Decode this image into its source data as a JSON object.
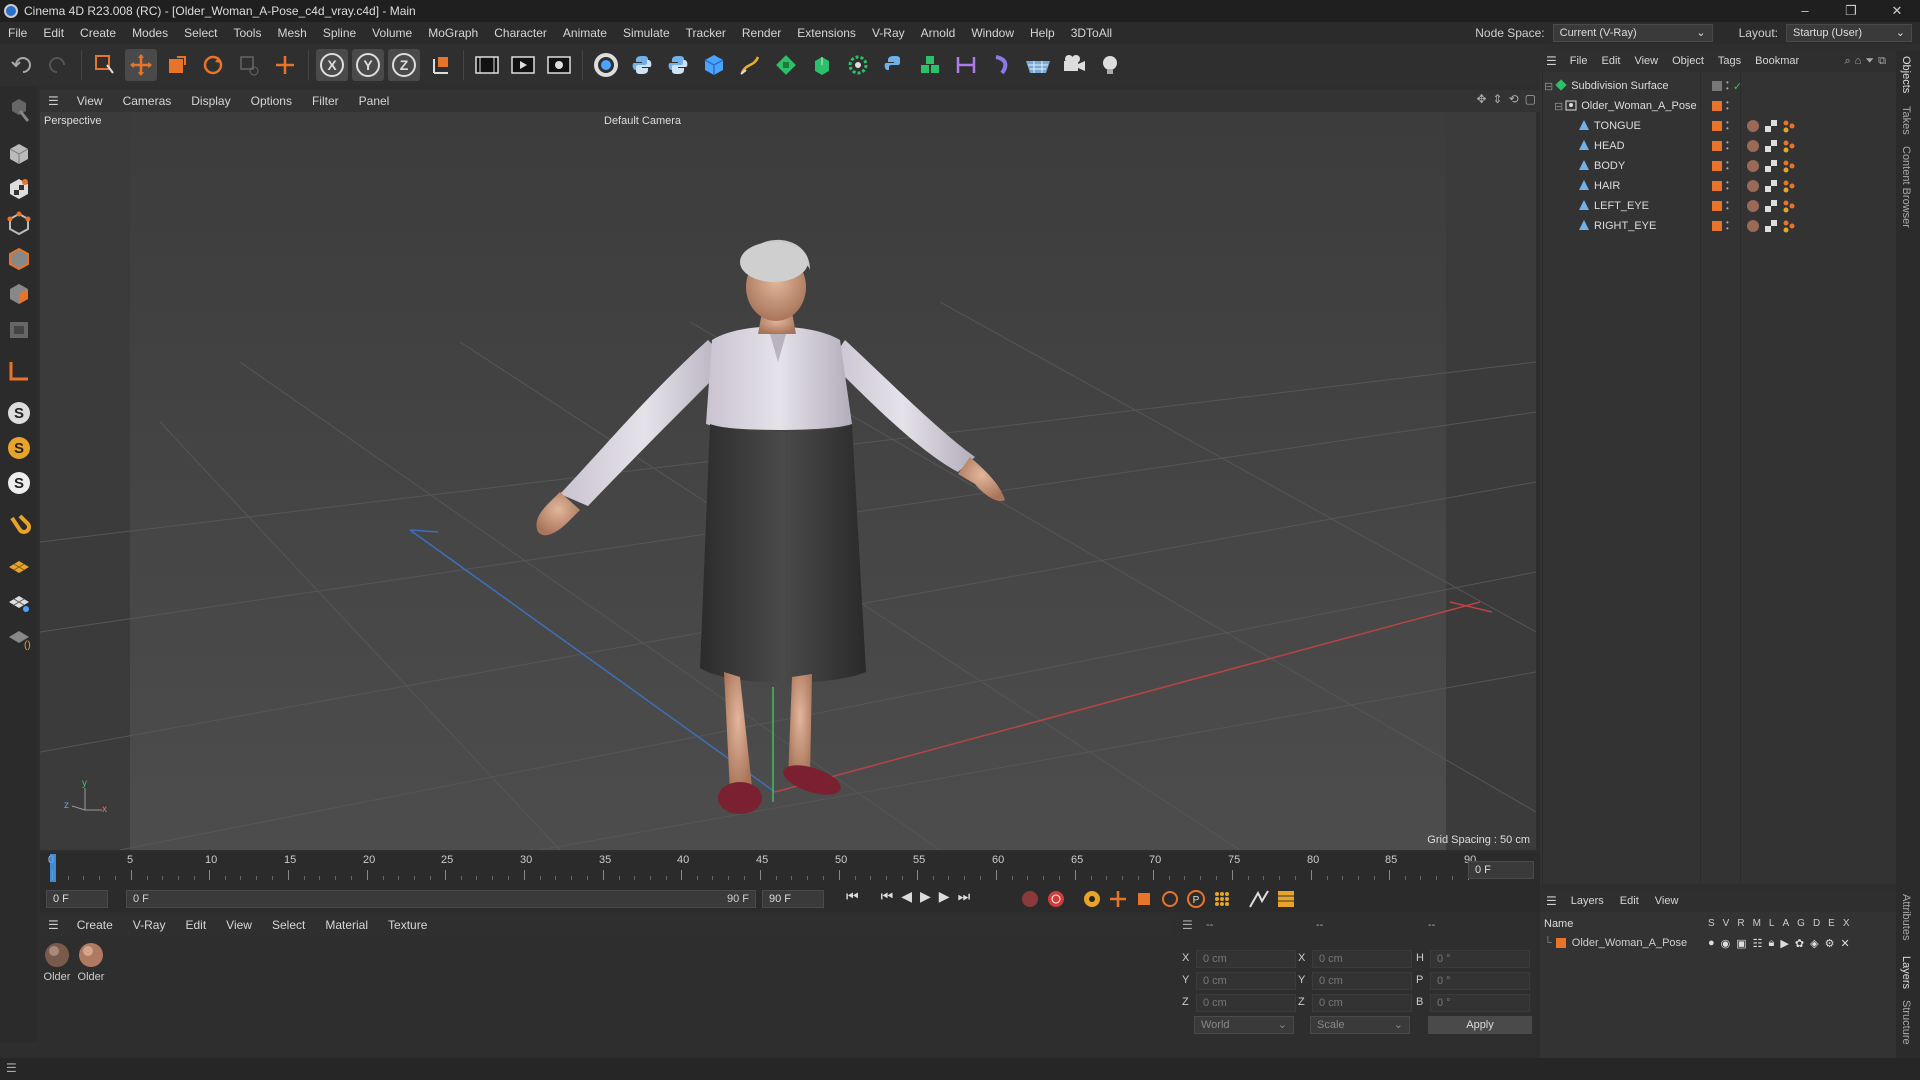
{
  "window": {
    "title": "Cinema 4D R23.008 (RC) - [Older_Woman_A-Pose_c4d_vray.c4d] - Main"
  },
  "menu": [
    "File",
    "Edit",
    "Create",
    "Modes",
    "Select",
    "Tools",
    "Mesh",
    "Spline",
    "Volume",
    "MoGraph",
    "Character",
    "Animate",
    "Simulate",
    "Tracker",
    "Render",
    "Extensions",
    "V-Ray",
    "Arnold",
    "Window",
    "Help",
    "3DToAll"
  ],
  "nodespace": {
    "label": "Node Space:",
    "value": "Current (V-Ray)"
  },
  "layout": {
    "label": "Layout:",
    "value": "Startup (User)"
  },
  "viewport": {
    "menu": [
      "View",
      "Cameras",
      "Display",
      "Options",
      "Filter",
      "Panel"
    ],
    "name": "Perspective",
    "camera": "Default Camera",
    "grid_spacing": "Grid Spacing : 50 cm",
    "axis": {
      "y": "y",
      "z": "z",
      "x": "x"
    }
  },
  "timeline": {
    "ticks": [
      "0",
      "5",
      "10",
      "15",
      "20",
      "25",
      "30",
      "35",
      "40",
      "45",
      "50",
      "55",
      "60",
      "65",
      "70",
      "75",
      "80",
      "85",
      "90"
    ],
    "current": "0 F",
    "start": "0 F",
    "range_start": "0 F",
    "range_end": "90 F",
    "end": "90 F"
  },
  "materials": {
    "menu": [
      "Create",
      "V-Ray",
      "Edit",
      "View",
      "Select",
      "Material",
      "Texture"
    ],
    "items": [
      {
        "label": "Older"
      },
      {
        "label": "Older"
      }
    ]
  },
  "coords": {
    "header": [
      "--",
      "--",
      "--"
    ],
    "rows": [
      {
        "a": "X",
        "av": "0 cm",
        "b": "X",
        "bv": "0 cm",
        "c": "H",
        "cv": "0 °"
      },
      {
        "a": "Y",
        "av": "0 cm",
        "b": "Y",
        "bv": "0 cm",
        "c": "P",
        "cv": "0 °"
      },
      {
        "a": "Z",
        "av": "0 cm",
        "b": "Z",
        "bv": "0 cm",
        "c": "B",
        "cv": "0 °"
      }
    ],
    "world": "World",
    "scale": "Scale",
    "apply": "Apply"
  },
  "objects": {
    "menu": [
      "File",
      "Edit",
      "View",
      "Object",
      "Tags",
      "Bookmar"
    ],
    "items": [
      {
        "name": "Subdivision Surface",
        "level": 0
      },
      {
        "name": "Older_Woman_A_Pose",
        "level": 1
      },
      {
        "name": "TONGUE",
        "level": 2
      },
      {
        "name": "HEAD",
        "level": 2
      },
      {
        "name": "BODY",
        "level": 2
      },
      {
        "name": "HAIR",
        "level": 2
      },
      {
        "name": "LEFT_EYE",
        "level": 2
      },
      {
        "name": "RIGHT_EYE",
        "level": 2
      }
    ]
  },
  "layers": {
    "menu": [
      "Layers",
      "Edit",
      "View"
    ],
    "header": {
      "name": "Name",
      "cols": [
        "S",
        "V",
        "R",
        "M",
        "L",
        "A",
        "G",
        "D",
        "E",
        "X"
      ]
    },
    "items": [
      {
        "name": "Older_Woman_A_Pose"
      }
    ]
  },
  "sidetabs": [
    "Objects",
    "Takes",
    "Content Browser",
    "Attributes",
    "Layers",
    "Structure"
  ],
  "colors": {
    "accent": "#e8742a",
    "background": "#2e2e2e",
    "viewport": "#4a4a4a"
  }
}
